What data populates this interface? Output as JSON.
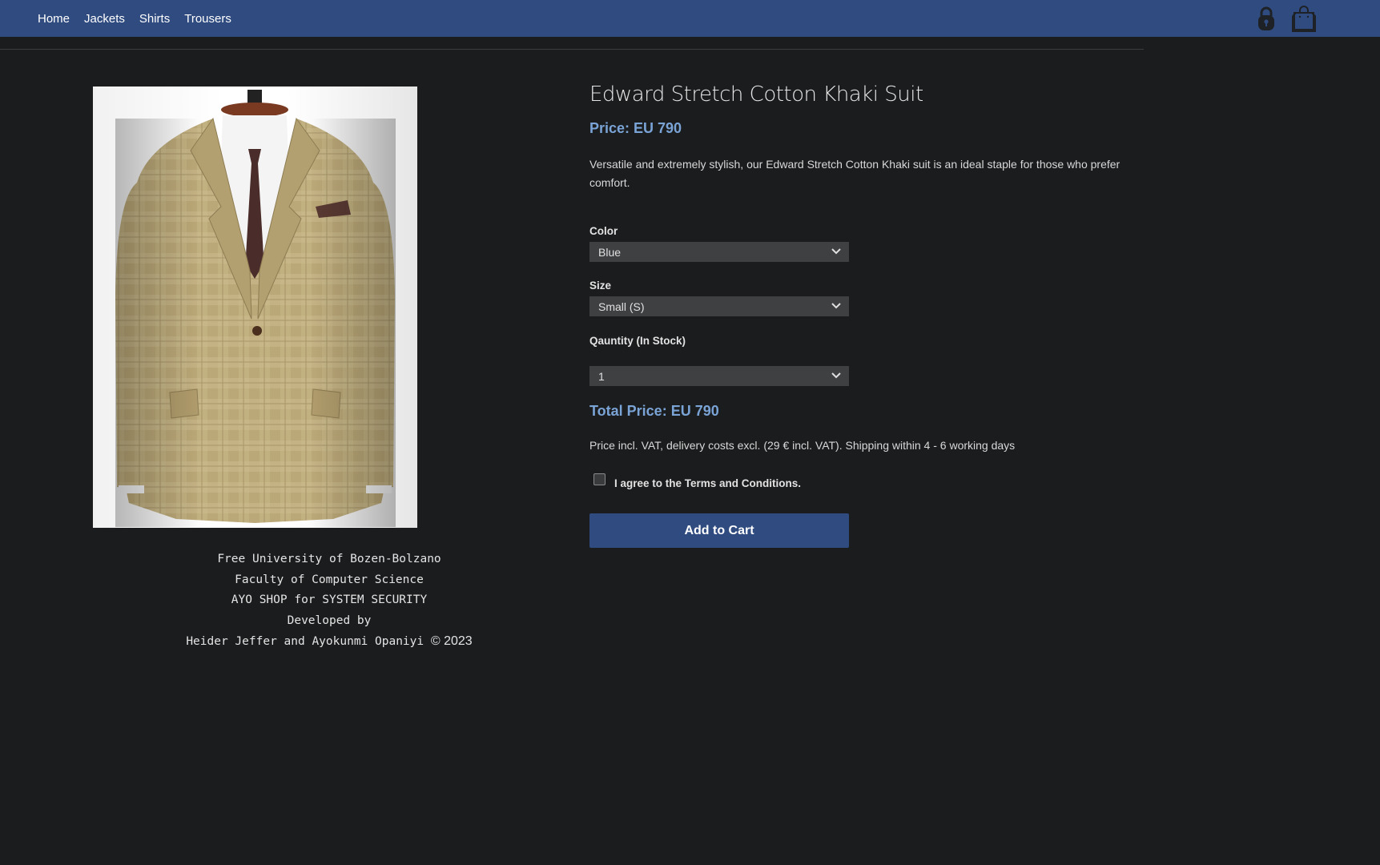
{
  "nav": {
    "links": [
      "Home",
      "Jackets",
      "Shirts",
      "Trousers"
    ],
    "icons": [
      "lock-icon",
      "shopping-bag-icon"
    ]
  },
  "product": {
    "title": "Edward Stretch Cotton Khaki Suit",
    "price_text": "Price: EU 790",
    "description": "Versatile and extremely stylish, our Edward Stretch Cotton Khaki suit is an ideal staple for those who prefer comfort.",
    "image_alt": "khaki checked suit jacket on mannequin"
  },
  "options": {
    "color_label": "Color",
    "color_value": "Blue",
    "size_label": "Size",
    "size_value": "Small (S)",
    "quantity_label": "Qauntity (In Stock)",
    "quantity_value": "1"
  },
  "total": {
    "text": "Total Price: EU 790"
  },
  "shipping_text": "Price incl. VAT, delivery costs excl. (29 € incl. VAT). Shipping within 4 - 6 working days",
  "terms": {
    "label": "I agree to the Terms and Conditions.",
    "checked": false
  },
  "add_to_cart_label": "Add to Cart",
  "footer": {
    "line1": "Free University of Bozen-Bolzano",
    "line2": "Faculty of Computer Science",
    "line3": "AYO SHOP for SYSTEM SECURITY",
    "line4": "Developed by",
    "line5_names": "Heider Jeffer and Ayokunmi Opaniyi",
    "line5_copyright": "© 2023"
  },
  "colors": {
    "navbar": "#2f4b80",
    "background": "#1b1c1e",
    "price_accent": "#7aa3d6",
    "select_bg": "#3f4042"
  }
}
